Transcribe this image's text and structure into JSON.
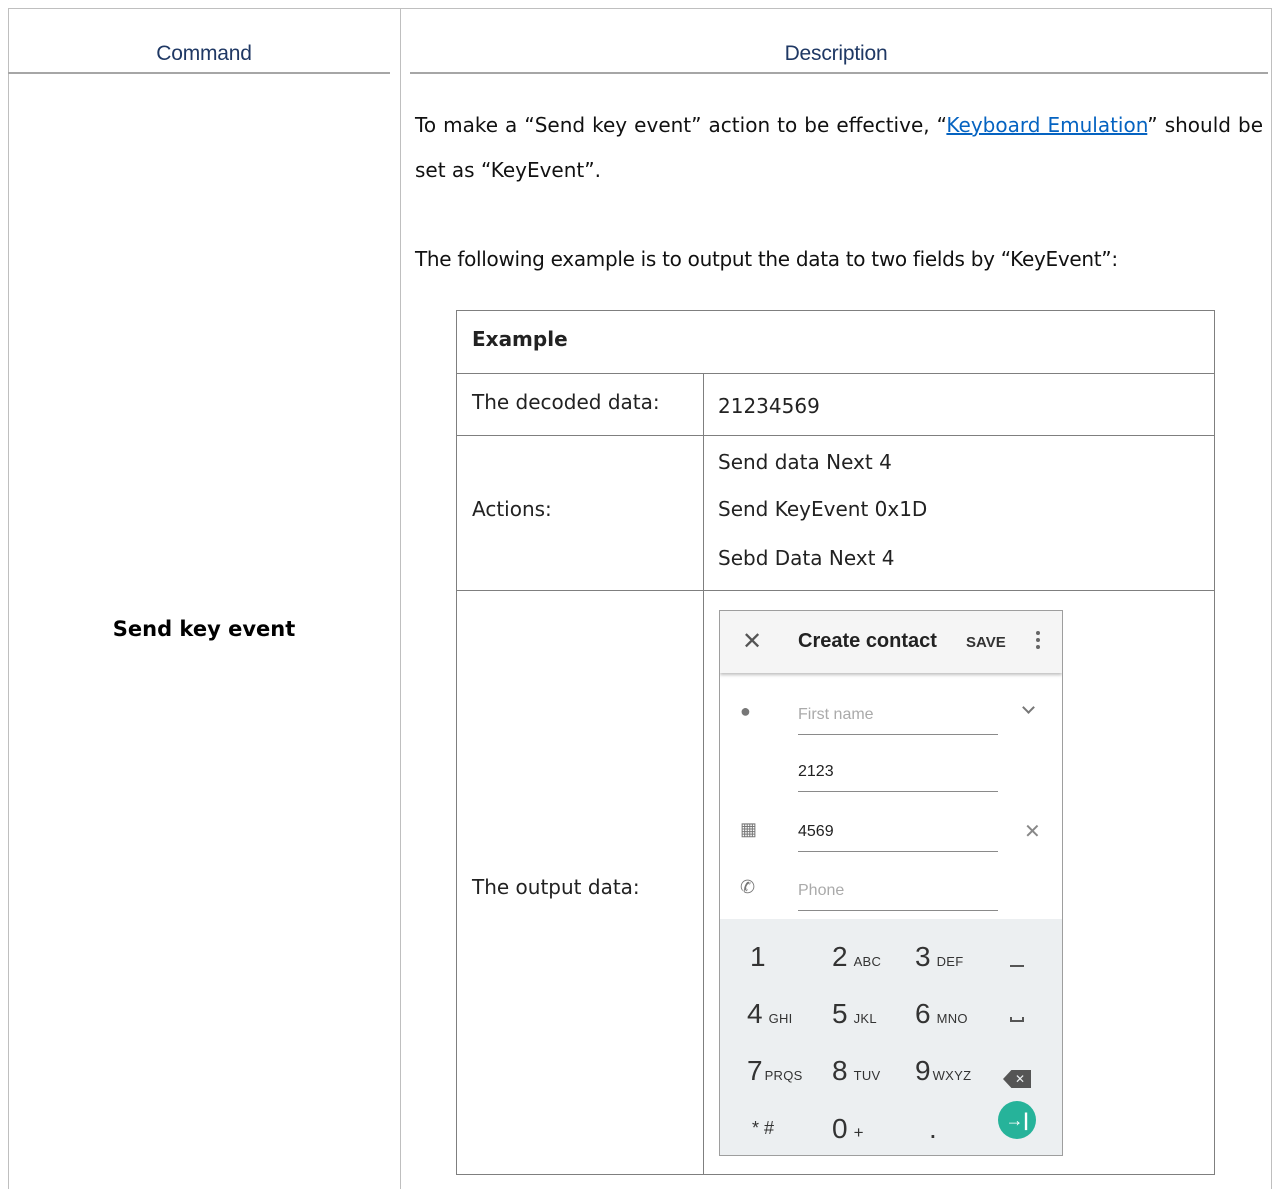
{
  "table": {
    "headers": {
      "command": "Command",
      "description": "Description"
    },
    "command": "Send key event"
  },
  "description": {
    "p1_pre": "To make a “Send key event” action to be effective, “",
    "p1_link": "Keyboard Emulation",
    "p1_post": "” should be set as “KeyEvent”.",
    "p2": "The following example is to output the data to two fields by “KeyEvent”:"
  },
  "example": {
    "title": "Example",
    "rows": [
      {
        "label": "The decoded data:",
        "value": "21234569"
      },
      {
        "label": "Actions:",
        "lines": [
          "Send data Next 4",
          "Send KeyEvent 0x1D",
          "Sebd Data Next 4"
        ]
      },
      {
        "label": "The output data:"
      }
    ]
  },
  "phone": {
    "title": "Create contact",
    "save": "SAVE",
    "close_icon": "close-icon",
    "fields": [
      {
        "placeholder": "First name",
        "icon": "person-icon"
      },
      {
        "value": "2123"
      },
      {
        "value": "4569",
        "icon": "building-icon"
      },
      {
        "placeholder": "Phone",
        "icon": "phone-icon"
      }
    ],
    "keys": [
      {
        "digit": "1",
        "letters": ""
      },
      {
        "digit": "2",
        "letters": "ABC"
      },
      {
        "digit": "3",
        "letters": "DEF"
      },
      {
        "digit": "4",
        "letters": "GHI"
      },
      {
        "digit": "5",
        "letters": "JKL"
      },
      {
        "digit": "6",
        "letters": "MNO"
      },
      {
        "digit": "7",
        "letters": "PRQS"
      },
      {
        "digit": "8",
        "letters": "TUV"
      },
      {
        "digit": "9",
        "letters": "WXYZ"
      },
      {
        "digit": "* #",
        "letters": ""
      },
      {
        "digit": "0",
        "letters": "+"
      },
      {
        "digit": ".",
        "letters": ""
      }
    ],
    "accent": "#26b39a"
  }
}
